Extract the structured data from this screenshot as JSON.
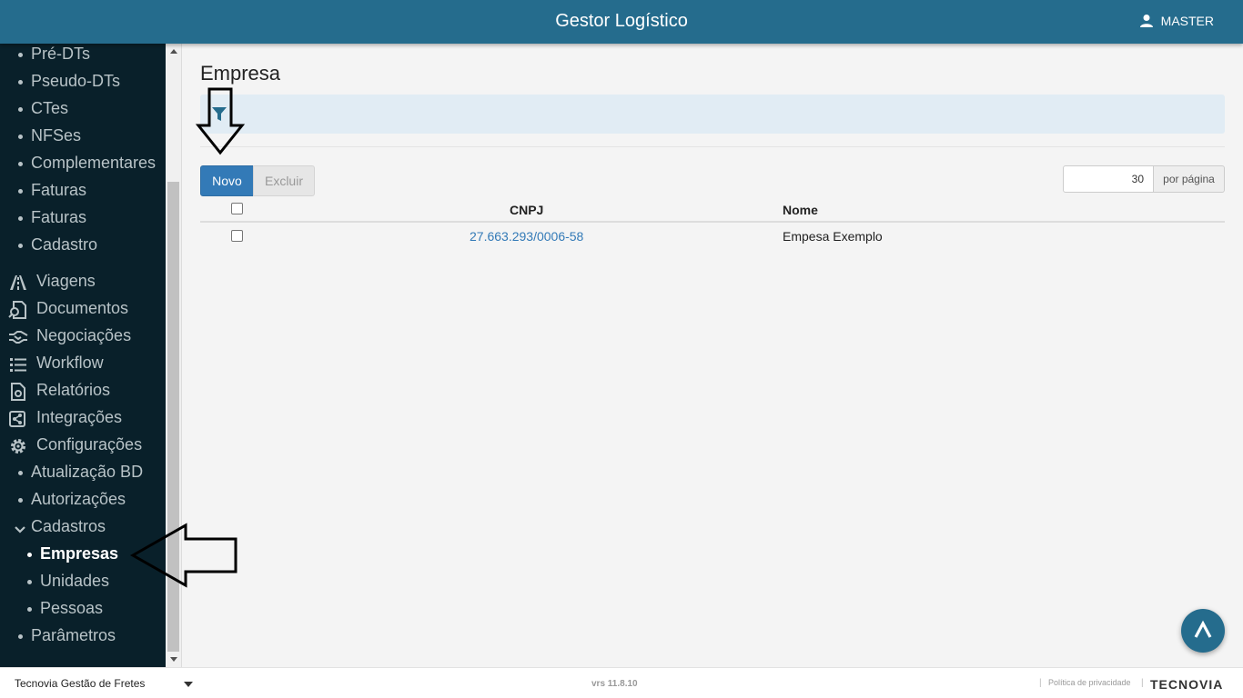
{
  "header": {
    "title": "Gestor Logístico",
    "user": "MASTER"
  },
  "sidebar": {
    "items": [
      {
        "label": "Pré-DTs",
        "type": "sub"
      },
      {
        "label": "Pseudo-DTs",
        "type": "sub"
      },
      {
        "label": "CTes",
        "type": "sub"
      },
      {
        "label": "NFSes",
        "type": "sub"
      },
      {
        "label": "Complementares",
        "type": "sub"
      },
      {
        "label": "Faturas",
        "type": "sub"
      },
      {
        "label": "Faturas",
        "type": "sub"
      },
      {
        "label": "Cadastro",
        "type": "sub"
      },
      {
        "label": "Viagens",
        "type": "main",
        "icon": "road-icon"
      },
      {
        "label": "Documentos",
        "type": "main",
        "icon": "document-search-icon"
      },
      {
        "label": "Negociações",
        "type": "main",
        "icon": "handshake-icon"
      },
      {
        "label": "Workflow",
        "type": "main",
        "icon": "list-icon"
      },
      {
        "label": "Relatórios",
        "type": "main",
        "icon": "report-icon"
      },
      {
        "label": "Integrações",
        "type": "main",
        "icon": "share-icon"
      },
      {
        "label": "Configurações",
        "type": "main",
        "icon": "gear-icon"
      },
      {
        "label": "Atualização BD",
        "type": "sub"
      },
      {
        "label": "Autorizações",
        "type": "sub"
      },
      {
        "label": "Cadastros",
        "type": "expanded",
        "icon": "chevron-down-icon"
      },
      {
        "label": "Empresas",
        "type": "subsub",
        "active": true
      },
      {
        "label": "Unidades",
        "type": "subsub"
      },
      {
        "label": "Pessoas",
        "type": "subsub"
      },
      {
        "label": "Parâmetros",
        "type": "sub"
      }
    ]
  },
  "main": {
    "title": "Empresa",
    "buttons": {
      "new": "Novo",
      "delete": "Excluir"
    },
    "per_page": {
      "value": "30",
      "label": "por página"
    },
    "table": {
      "columns": [
        "CNPJ",
        "Nome"
      ],
      "rows": [
        {
          "cnpj": "27.663.293/0006-58",
          "nome": "Empesa Exemplo"
        }
      ]
    }
  },
  "footer": {
    "company": "Tecnovia Gestão de Fretes",
    "version": "vrs 11.8.10",
    "privacy": "Política de privacidade",
    "logo": "TECNOVIA"
  },
  "colors": {
    "header": "#256c8d",
    "sidebar": "#09202a",
    "primary": "#337ab7",
    "filter_bar": "#e1ecf4"
  }
}
